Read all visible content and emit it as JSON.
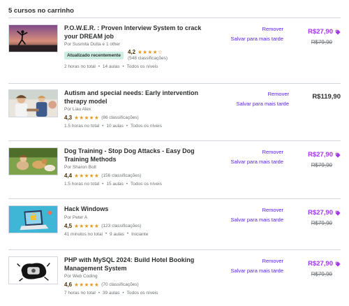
{
  "cart": {
    "heading": "5 cursos no carrinho"
  },
  "items": [
    {
      "title_line1": "P.O.W.E.R. : Proven Interview System to crack",
      "title_line2": "your DREAM job",
      "author": "Por Susmita Dutta e 1 other",
      "badge": "Atualizado recentemente",
      "rating": "4,2",
      "stars": "★★★★☆",
      "reviews": "(548 classificações)",
      "hours": "2 horas no total",
      "lectures": "14 aulas",
      "level": "Todos os níveis",
      "remove": "Remover",
      "save": "Salvar para mais tarde",
      "price": "R$27,90",
      "original_price": "R$79,90"
    },
    {
      "title_line1": "Autism and special needs: Early intervention",
      "title_line2": "therapy model",
      "author": "Por Liau Alex",
      "rating": "4,3",
      "stars": "★★★★★",
      "reviews": "(86 classificações)",
      "hours": "1.5 horas no total",
      "lectures": "10 aulas",
      "level": "Todos os níveis",
      "remove": "Remover",
      "save": "Salvar para mais tarde",
      "price": "R$119,90"
    },
    {
      "title_line1": "Dog Training - Stop Dog Attacks - Easy Dog",
      "title_line2": "Training Methods",
      "author": "Por Sharon Bolt",
      "rating": "4,4",
      "stars": "★★★★★",
      "reviews": "(156 classificações)",
      "hours": "1.5 horas no total",
      "lectures": "15 aulas",
      "level": "Todos os níveis",
      "remove": "Remover",
      "save": "Salvar para mais tarde",
      "price": "R$27,90",
      "original_price": "R$79,90"
    },
    {
      "title_line1": "Hack Windows",
      "title_line2": "",
      "author": "Por Peter A",
      "rating": "4,5",
      "stars": "★★★★★",
      "reviews": "(123 classificações)",
      "hours": "41 minutos no total",
      "lectures": "9 aulas",
      "level": "Iniciante",
      "remove": "Remover",
      "save": "Salvar para mais tarde",
      "price": "R$27,90",
      "original_price": "R$79,90"
    },
    {
      "title_line1": "PHP with MySQL 2024: Build Hotel Booking",
      "title_line2": "Management System",
      "author": "Por Web Coding",
      "rating": "4,6",
      "stars": "★★★★★",
      "reviews": "(70 classificações)",
      "hours": "7 horas no total",
      "lectures": "39 aulas",
      "level": "Todos os níveis",
      "remove": "Remover",
      "save": "Salvar para mais tarde",
      "price": "R$27,90",
      "original_price": "R$79,90"
    }
  ],
  "colors": {
    "accent_purple": "#a435f0",
    "link_purple": "#5624d0",
    "star_orange": "#e59819",
    "badge_bg": "#cceee0"
  },
  "icons": {
    "price_tag": "price-tag-icon"
  }
}
